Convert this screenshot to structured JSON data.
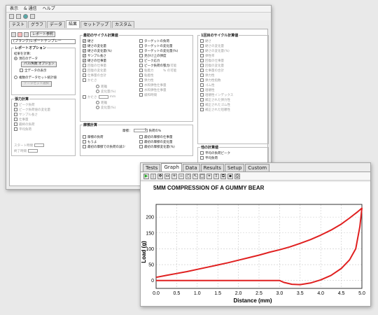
{
  "win1": {
    "menu": [
      "表示",
      "& 通信",
      "ヘルプ"
    ],
    "tabs": [
      "テスト",
      "グラフ",
      "データ",
      "結果",
      "セットアップ",
      "カスタム"
    ],
    "active_tab": "結果",
    "report_button": "レポート参照",
    "template_select": "(ブランク)レポートテンプレー",
    "report_options": {
      "title": "レポートオプション",
      "data_label": "結果を計算：",
      "radio_current": "現在のデータ",
      "btn_pass_fail": "パス/失敗 オプション",
      "show_all": "全データの表示",
      "radio_multi": "複数のデータセット統計値",
      "btn_select_dataset": "データセット選択"
    },
    "force_stats": {
      "title": "張力計算",
      "items": [
        "ピーク負荷",
        "ピーク負荷値の変化量",
        "サンプル長さ",
        "仕事量",
        "最終の負荷",
        "平均負荷"
      ],
      "start_label": "スタート時間",
      "end_label": "終了時間"
    },
    "cycle_stats": {
      "title": "最初のサイクル計算値",
      "col1": [
        {
          "label": "硬さ",
          "on": true
        },
        {
          "label": "硬さの変化量",
          "on": true
        },
        {
          "label": "硬さの変化量(%)",
          "on": true
        },
        {
          "label": "サンプル長さ",
          "on": true
        },
        {
          "label": "硬さの仕事量",
          "on": true
        },
        {
          "label": "回復の仕事量",
          "on": false
        },
        {
          "label": "回復の変化量",
          "on": false
        },
        {
          "label": "仕事量の合計",
          "on": false
        },
        {
          "label": "かたさ",
          "on": false
        }
      ],
      "col2": [
        {
          "label": "ターゲットの負荷",
          "on": false
        },
        {
          "label": "ターゲットの変化量",
          "on": false
        },
        {
          "label": "ターゲットの変化量(%)",
          "on": false
        },
        {
          "label": "見かけ上の弾度",
          "on": false
        },
        {
          "label": "ピーク応力",
          "on": false
        },
        {
          "label": "ピーク負荷の張力",
          "on": false
        },
        {
          "label": "粘着力",
          "on": false
        },
        {
          "label": "粘着性",
          "on": false
        },
        {
          "label": "弾力性",
          "on": false
        },
        {
          "label": "水和弾性仕事量",
          "on": false
        },
        {
          "label": "水和弾性仕事量",
          "on": false
        },
        {
          "label": "緩和時間",
          "on": false
        }
      ],
      "units": [
        "mm",
        "% の可能",
        "% の可能"
      ],
      "sub_radios": [
        "距離",
        "変化量(%)",
        "距離",
        "変化量(%)"
      ]
    },
    "second_cycle": {
      "title": "1回目のサイクル計算値",
      "items": [
        "硬さ",
        "硬さの変化量",
        "硬さの変化量(%)",
        "弾性率",
        "回復の仕事量",
        "回復の変化量",
        "仕事量の合計",
        "弾力性",
        "弾力性指数",
        "ゴム性",
        "咀嚼性",
        "咀嚼性インデックス",
        "補正された弾力性",
        "補正されたゴム性",
        "補正された咀嚼性"
      ]
    },
    "friction": {
      "title": "摩擦計算",
      "angle_label": "摩擦：",
      "angle_value": "1",
      "angle_unit": "負荷の%",
      "col1": [
        "摩擦の負荷",
        "もうよ",
        "最初の摩擦での負荷の減少"
      ],
      "col2": [
        "最初の摩擦の仕事量",
        "最初の摩擦の変化量",
        "最初の摩擦変化量(%)"
      ]
    },
    "peel": {
      "title": "他の計算値",
      "items": [
        "平均の負荷ピーク",
        "平均負荷"
      ],
      "start_label": "スタート時間",
      "end_label": "終了時間"
    }
  },
  "win2": {
    "tabs": [
      "Tests",
      "Graph",
      "Data",
      "Results",
      "Setup",
      "Custom"
    ],
    "active_tab": "Graph"
  },
  "chart_data": {
    "type": "line",
    "title": "5MM COMPRESSION OF A GUMMY BEAR",
    "xlabel": "Distance (mm)",
    "ylabel": "Load (g)",
    "xlim": [
      0,
      5
    ],
    "ylim": [
      -25,
      240
    ],
    "x_ticks": [
      "0.0",
      "0.5",
      "1.0",
      "1.5",
      "2.0",
      "2.5",
      "3.0",
      "3.5",
      "4.0",
      "4.5",
      "5.0"
    ],
    "y_ticks": [
      "0",
      "50",
      "100",
      "150",
      "200"
    ],
    "grid": true,
    "series": [
      {
        "color": "#e02020",
        "x": [
          0.0,
          0.25,
          0.5,
          0.75,
          1.0,
          1.25,
          1.5,
          1.75,
          2.0,
          2.25,
          2.5,
          2.75,
          3.0,
          3.25,
          3.5,
          3.75,
          4.0,
          4.25,
          4.5,
          4.7,
          4.9,
          5.0,
          4.95,
          4.85,
          4.7,
          4.5,
          4.25,
          4.0,
          3.75,
          3.5,
          3.3,
          3.1,
          3.0,
          2.0,
          1.0,
          0.0
        ],
        "y": [
          10,
          16,
          22,
          28,
          35,
          42,
          49,
          56,
          64,
          72,
          80,
          89,
          97,
          106,
          117,
          129,
          143,
          159,
          178,
          197,
          217,
          228,
          170,
          100,
          65,
          38,
          16,
          2,
          -8,
          -13,
          -12,
          -6,
          0,
          0,
          0,
          0
        ]
      }
    ]
  }
}
